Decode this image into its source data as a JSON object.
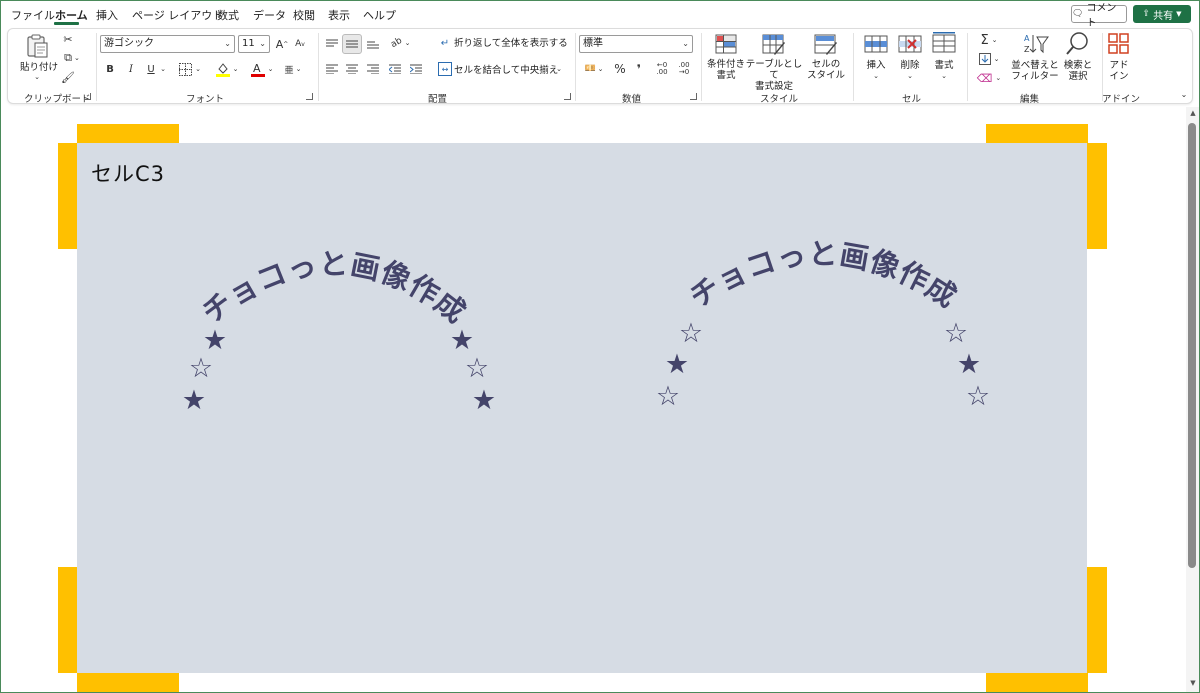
{
  "menu": {
    "items": [
      "ファイル",
      "ホーム",
      "挿入",
      "ページ レイアウト",
      "数式",
      "データ",
      "校閲",
      "表示",
      "ヘルプ"
    ],
    "active": "ホーム",
    "comment_label": "コメント",
    "share_label": "共有"
  },
  "ribbon": {
    "clipboard": {
      "paste_label": "貼り付け",
      "group_label": "クリップボード"
    },
    "font": {
      "font_name": "游ゴシック",
      "font_size": "11",
      "bold": "B",
      "italic": "I",
      "underline": "U",
      "group_label": "フォント"
    },
    "alignment": {
      "wrap_text": "折り返して全体を表示する",
      "merge_center": "セルを結合して中央揃え",
      "group_label": "配置"
    },
    "number": {
      "format": "標準",
      "group_label": "数値"
    },
    "styles": {
      "conditional": "条件付き\n書式",
      "table": "テーブルとして\n書式設定",
      "cell_styles": "セルの\nスタイル",
      "group_label": "スタイル"
    },
    "cells": {
      "insert": "挿入",
      "delete": "削除",
      "format": "書式",
      "group_label": "セル"
    },
    "editing": {
      "sort_filter": "並べ替えと\nフィルター",
      "find_select": "検索と\n選択",
      "group_label": "編集"
    },
    "addins": {
      "addins": "アド\nイン",
      "group_label": "アドイン"
    }
  },
  "sheet": {
    "cell_label": "セルC3",
    "arc_text": "チョコっと画像作成",
    "colors": {
      "shape_fill": "#d6dce4",
      "accent_yellow": "#ffc000",
      "text_color": "#44446a"
    },
    "left_arc_stars": [
      "★",
      "☆",
      "★",
      "★",
      "☆",
      "★"
    ],
    "right_arc_stars": [
      "☆",
      "★",
      "☆",
      "☆",
      "★",
      "☆"
    ]
  }
}
